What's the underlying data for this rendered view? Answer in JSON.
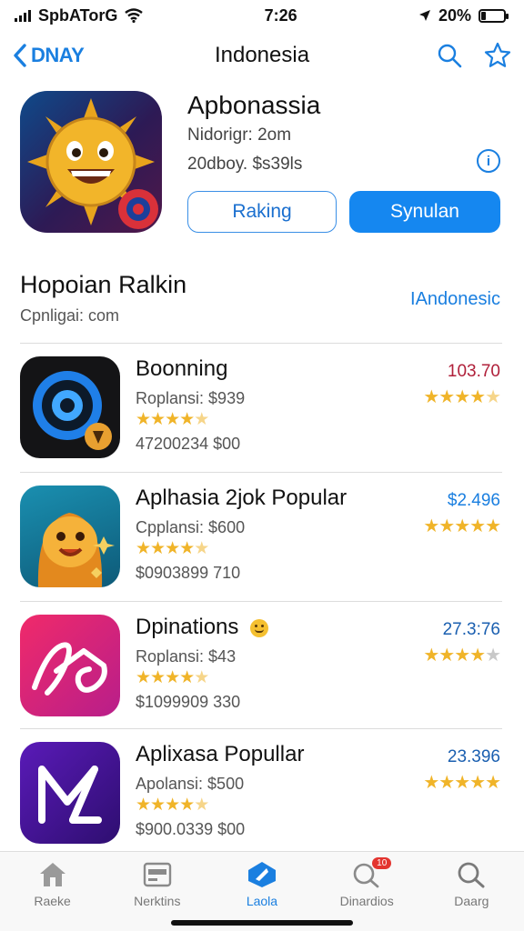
{
  "status": {
    "carrier": "SpbATorG",
    "time": "7:26",
    "battery": "20%",
    "battery_level": 0.2
  },
  "nav": {
    "back_label": "DNAY",
    "title": "Indonesia"
  },
  "hero": {
    "name": "Apbonassia",
    "subtitle": "Nidorigr: 2om",
    "price": "20dboy. $s39ls",
    "info_label": "i",
    "secondary_button": "Raking",
    "primary_button": "Synulan"
  },
  "section": {
    "title": "Hopoian Ralkin",
    "subtitle": "Cpnligai: com",
    "link": "IAndonesic"
  },
  "apps": [
    {
      "name": "Boonning",
      "subtitle": "Roplansi: $939",
      "meta": "47200234 $00",
      "score": "103.70",
      "score_color": "#b0203a",
      "rating": 4.5,
      "right_rating": 4.5
    },
    {
      "name": "Aplhasia 2jok Popular",
      "subtitle": "Cpplansi: $600",
      "meta": "$0903899 710",
      "score": "$2.496",
      "score_color": "#1a7fe0",
      "rating": 4.5,
      "right_rating": 5
    },
    {
      "name": "Dpinations",
      "subtitle": "Roplansi: $43",
      "meta": "$1099909 330",
      "score": "27.3:76",
      "score_color": "#1a5fb0",
      "rating": 4.5,
      "right_rating": 4
    },
    {
      "name": "Aplixasa Popullar",
      "subtitle": "Apolansi: $500",
      "meta": "$900.0339 $00",
      "score": "23.396",
      "score_color": "#1a5fb0",
      "rating": 4.5,
      "right_rating": 5
    }
  ],
  "tabs": [
    {
      "label": "Raeke",
      "icon": "home-icon",
      "active": false
    },
    {
      "label": "Nerktins",
      "icon": "card-icon",
      "active": false
    },
    {
      "label": "Laola",
      "icon": "apps-icon",
      "active": true
    },
    {
      "label": "Dinardios",
      "icon": "search-badge-icon",
      "active": false,
      "badge": "10"
    },
    {
      "label": "Daarg",
      "icon": "search-icon",
      "active": false
    }
  ],
  "colors": {
    "accent": "#1a7fe0",
    "star": "#f0b429"
  }
}
